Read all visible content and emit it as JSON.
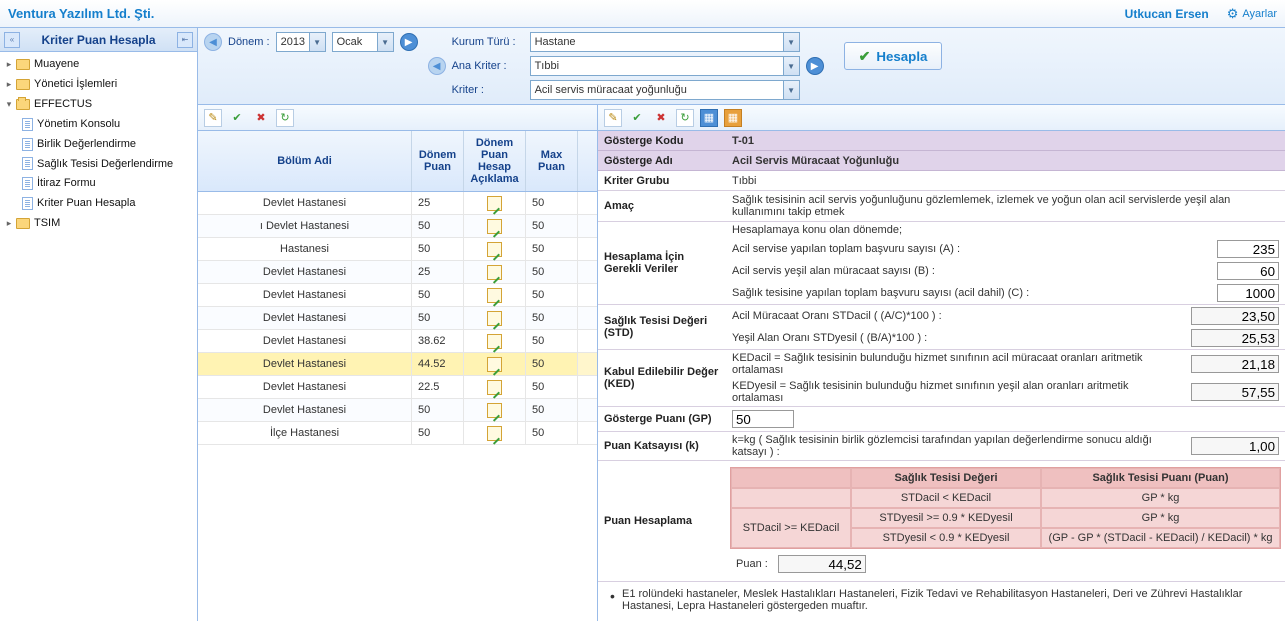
{
  "topbar": {
    "company": "Ventura Yazılım Ltd. Şti.",
    "user": "Utkucan Ersen",
    "settings": "Ayarlar"
  },
  "sidebar": {
    "title": "Kriter Puan Hesapla",
    "items": [
      {
        "type": "folder",
        "label": "Muayene"
      },
      {
        "type": "folder",
        "label": "Yönetici İşlemleri"
      },
      {
        "type": "folder-open",
        "label": "EFFECTUS"
      },
      {
        "type": "doc",
        "label": "Yönetim Konsolu"
      },
      {
        "type": "doc",
        "label": "Birlik Değerlendirme"
      },
      {
        "type": "doc",
        "label": "Sağlık Tesisi Değerlendirme"
      },
      {
        "type": "doc",
        "label": "İtiraz Formu"
      },
      {
        "type": "doc",
        "label": "Kriter Puan Hesapla"
      },
      {
        "type": "folder",
        "label": "TSIM"
      }
    ]
  },
  "filters": {
    "donem_label": "Dönem :",
    "year": "2013",
    "month": "Ocak",
    "kurum_label": "Kurum Türü :",
    "kurum": "Hastane",
    "anakriter_label": "Ana Kriter :",
    "anakriter": "Tıbbi",
    "kriter_label": "Kriter :",
    "kriter": "Acil servis müracaat yoğunluğu",
    "hesapla": "Hesapla"
  },
  "grid": {
    "headers": {
      "bolum": "Bölüm Adi",
      "dp": "Dönem Puan",
      "dpha": "Dönem Puan Hesap Açıklama",
      "mp": "Max Puan"
    },
    "rows": [
      {
        "bolum": "Devlet Hastanesi",
        "dp": "25",
        "mp": "50"
      },
      {
        "bolum": "ı Devlet Hastanesi",
        "dp": "50",
        "mp": "50"
      },
      {
        "bolum": "Hastanesi",
        "dp": "50",
        "mp": "50"
      },
      {
        "bolum": "Devlet Hastanesi",
        "dp": "25",
        "mp": "50"
      },
      {
        "bolum": "Devlet Hastanesi",
        "dp": "50",
        "mp": "50"
      },
      {
        "bolum": "Devlet Hastanesi",
        "dp": "50",
        "mp": "50"
      },
      {
        "bolum": "Devlet Hastanesi",
        "dp": "38.62",
        "mp": "50"
      },
      {
        "bolum": "Devlet Hastanesi",
        "dp": "44.52",
        "mp": "50",
        "selected": true
      },
      {
        "bolum": "Devlet Hastanesi",
        "dp": "22.5",
        "mp": "50"
      },
      {
        "bolum": "Devlet Hastanesi",
        "dp": "50",
        "mp": "50"
      },
      {
        "bolum": "İlçe Hastanesi",
        "dp": "50",
        "mp": "50"
      }
    ]
  },
  "detail": {
    "kod_label": "Gösterge Kodu",
    "kod": "T-01",
    "ad_label": "Gösterge Adı",
    "ad": "Acil Servis Müracaat Yoğunluğu",
    "grup_label": "Kriter Grubu",
    "grup": "Tıbbi",
    "amac_label": "Amaç",
    "amac": "Sağlık tesisinin acil servis yoğunluğunu gözlemlemek, izlemek ve yoğun olan acil servislerde yeşil alan kullanımını takip etmek",
    "hesver_label": "Hesaplama İçin Gerekli Veriler",
    "hesver_intro": "Hesaplamaya konu olan dönemde;",
    "a_lab": "Acil servise yapılan toplam başvuru sayısı (A) :",
    "a_val": "235",
    "b_lab": "Acil servis yeşil alan müracaat sayısı (B) :",
    "b_val": "60",
    "c_lab": "Sağlık tesisine yapılan toplam başvuru sayısı (acil dahil) (C) :",
    "c_val": "1000",
    "std_label": "Sağlık Tesisi Değeri (STD)",
    "std1_lab": "Acil Müracaat Oranı STDacil ( (A/C)*100 ) :",
    "std1_val": "23,50",
    "std2_lab": "Yeşil Alan Oranı STDyesil ( (B/A)*100 ) :",
    "std2_val": "25,53",
    "ked_label": "Kabul Edilebilir Değer (KED)",
    "ked1_lab": "KEDacil = Sağlık tesisinin bulunduğu hizmet sınıfının acil müracaat oranları aritmetik ortalaması",
    "ked1_val": "21,18",
    "ked2_lab": "KEDyesil = Sağlık tesisinin bulunduğu hizmet sınıfının yeşil alan oranları aritmetik ortalaması",
    "ked2_val": "57,55",
    "gp_label": "Gösterge Puanı (GP)",
    "gp_val": "50",
    "k_label": "Puan Katsayısı (k)",
    "k_desc": "k=kg ( Sağlık tesisinin birlik gözlemcisi tarafından yapılan değerlendirme sonucu aldığı katsayı ) :",
    "k_val": "1,00",
    "ph_label": "Puan Hesaplama",
    "ptable": {
      "h1": "Sağlık Tesisi Değeri",
      "h2": "Sağlık Tesisi Puanı (Puan)",
      "r1c1": "STDacil < KEDacil",
      "r1c2": "GP * kg",
      "merge": "STDacil >= KEDacil",
      "r2c1": "STDyesil >= 0.9 * KEDyesil",
      "r2c2": "GP * kg",
      "r3c1": "STDyesil < 0.9 * KEDyesil",
      "r3c2": "(GP - GP * (STDacil - KEDacil) / KEDacil) * kg"
    },
    "puan_lab": "Puan :",
    "puan_val": "44,52",
    "note": "E1 rolündeki hastaneler, Meslek Hastalıkları Hastaneleri, Fizik Tedavi ve Rehabilitasyon Hastaneleri, Deri ve Zührevi Hastalıklar Hastanesi, Lepra Hastaneleri göstergeden muaftır."
  }
}
